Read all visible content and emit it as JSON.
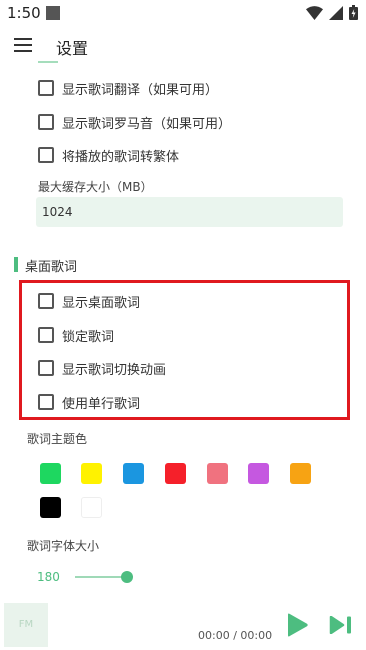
{
  "status_bar": {
    "time": "1:50"
  },
  "app_bar": {
    "title": "设置"
  },
  "lyrics_options": [
    "显示歌词翻译（如果可用）",
    "显示歌词罗马音（如果可用）",
    "将播放的歌词转繁体"
  ],
  "cache": {
    "label": "最大缓存大小（MB）",
    "value": "1024"
  },
  "desktop_lyrics": {
    "section_title": "桌面歌词",
    "options": [
      "显示桌面歌词",
      "锁定歌词",
      "显示歌词切换动画",
      "使用单行歌词"
    ]
  },
  "theme_color": {
    "label": "歌词主题色",
    "colors": [
      "#1ed760",
      "#fff200",
      "#1b96e0",
      "#f5202a",
      "#f0727f",
      "#c558e0",
      "#f7a313",
      "#000000",
      "#ffffff"
    ]
  },
  "font_size": {
    "label": "歌词字体大小",
    "value": "180",
    "fraction": 0.35
  },
  "player": {
    "cover_text": "FM",
    "time": "00:00 / 00:00"
  },
  "accent_color": "#4dbd80"
}
